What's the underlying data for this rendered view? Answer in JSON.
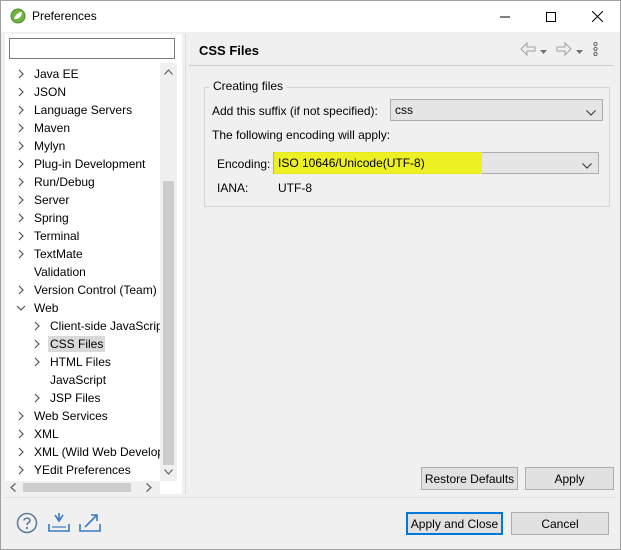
{
  "window": {
    "title": "Preferences"
  },
  "filter": {
    "value": ""
  },
  "tree": [
    {
      "label": "Java EE",
      "expanded": false,
      "level": 0
    },
    {
      "label": "JSON",
      "expanded": false,
      "level": 0
    },
    {
      "label": "Language Servers",
      "expanded": false,
      "level": 0
    },
    {
      "label": "Maven",
      "expanded": false,
      "level": 0
    },
    {
      "label": "Mylyn",
      "expanded": false,
      "level": 0
    },
    {
      "label": "Plug-in Development",
      "expanded": false,
      "level": 0
    },
    {
      "label": "Run/Debug",
      "expanded": false,
      "level": 0
    },
    {
      "label": "Server",
      "expanded": false,
      "level": 0
    },
    {
      "label": "Spring",
      "expanded": false,
      "level": 0
    },
    {
      "label": "Terminal",
      "expanded": false,
      "level": 0
    },
    {
      "label": "TextMate",
      "expanded": false,
      "level": 0
    },
    {
      "label": "Validation",
      "leaf": true,
      "level": 0
    },
    {
      "label": "Version Control (Team)",
      "expanded": false,
      "level": 0
    },
    {
      "label": "Web",
      "expanded": true,
      "level": 0
    },
    {
      "label": "Client-side JavaScript",
      "expanded": false,
      "level": 1
    },
    {
      "label": "CSS Files",
      "expanded": false,
      "level": 1,
      "selected": true
    },
    {
      "label": "HTML Files",
      "expanded": false,
      "level": 1
    },
    {
      "label": "JavaScript",
      "leaf": true,
      "level": 1
    },
    {
      "label": "JSP Files",
      "expanded": false,
      "level": 1
    },
    {
      "label": "Web Services",
      "expanded": false,
      "level": 0
    },
    {
      "label": "XML",
      "expanded": false,
      "level": 0
    },
    {
      "label": "XML (Wild Web Developer)",
      "expanded": false,
      "level": 0
    },
    {
      "label": "YEdit Preferences",
      "expanded": false,
      "level": 0
    }
  ],
  "page": {
    "title": "CSS Files",
    "group_label": "Creating files",
    "suffix_label": "Add this suffix (if not specified):",
    "suffix_value": "css",
    "encoding_note": "The following encoding will apply:",
    "encoding_label": "Encoding:",
    "encoding_value": "ISO 10646/Unicode(UTF-8)",
    "iana_label": "IANA:",
    "iana_value": "UTF-8"
  },
  "buttons": {
    "restore_defaults": "Restore Defaults",
    "apply": "Apply",
    "apply_and_close": "Apply and Close",
    "cancel": "Cancel"
  },
  "colors": {
    "highlight": "#eef200",
    "default_button_border": "#0078d7",
    "selection": "#d9d9d9"
  }
}
